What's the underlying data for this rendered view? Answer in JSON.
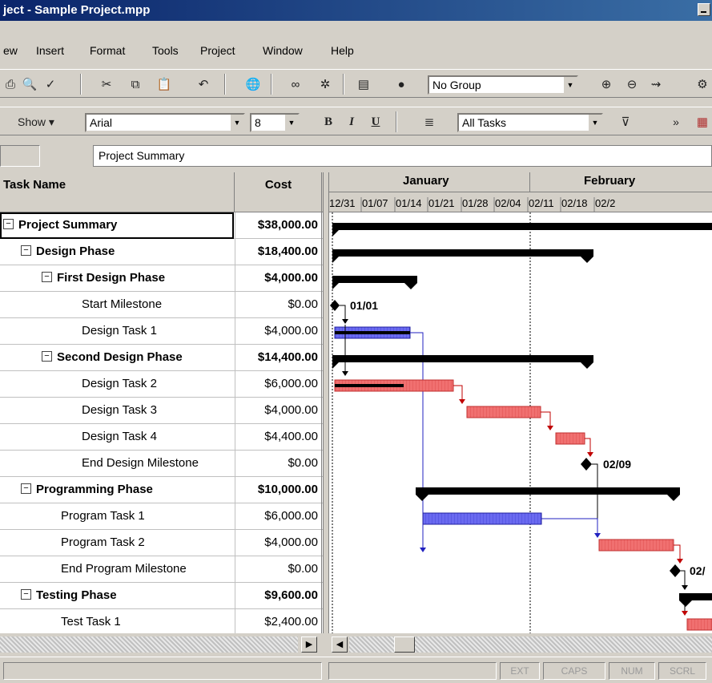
{
  "window": {
    "title": "ject - Sample Project.mpp"
  },
  "menu": [
    {
      "label": "ew"
    },
    {
      "label": "Insert"
    },
    {
      "label": "Format"
    },
    {
      "label": "Tools"
    },
    {
      "label": "Project"
    },
    {
      "label": "Window"
    },
    {
      "label": "Help"
    }
  ],
  "toolbar1": {
    "group_value": "No Group"
  },
  "toolbar2": {
    "show_label": "Show ▾",
    "font_value": "Arial",
    "size_value": "8",
    "filter_value": "All Tasks",
    "more": "»"
  },
  "entry_bar": {
    "value": "Project Summary"
  },
  "table": {
    "header_name": "Task Name",
    "header_cost": "Cost",
    "rows": [
      {
        "name": "Project Summary",
        "cost": "$38,000.00"
      },
      {
        "name": "Design Phase",
        "cost": "$18,400.00"
      },
      {
        "name": "First Design Phase",
        "cost": "$4,000.00"
      },
      {
        "name": "Start Milestone",
        "cost": "$0.00"
      },
      {
        "name": "Design Task 1",
        "cost": "$4,000.00"
      },
      {
        "name": "Second Design Phase",
        "cost": "$14,400.00"
      },
      {
        "name": "Design Task 2",
        "cost": "$6,000.00"
      },
      {
        "name": "Design Task 3",
        "cost": "$4,000.00"
      },
      {
        "name": "Design Task 4",
        "cost": "$4,400.00"
      },
      {
        "name": "End Design Milestone",
        "cost": "$0.00"
      },
      {
        "name": "Programming Phase",
        "cost": "$10,000.00"
      },
      {
        "name": "Program Task 1",
        "cost": "$6,000.00"
      },
      {
        "name": "Program Task 2",
        "cost": "$4,000.00"
      },
      {
        "name": "End Program Milestone",
        "cost": "$0.00"
      },
      {
        "name": "Testing Phase",
        "cost": "$9,600.00"
      },
      {
        "name": "Test Task 1",
        "cost": "$2,400.00"
      }
    ]
  },
  "gantt": {
    "months": [
      "January",
      "February"
    ],
    "weeks": [
      "12/31",
      "01/07",
      "01/14",
      "01/21",
      "01/28",
      "02/04",
      "02/11",
      "02/18",
      "02/2"
    ],
    "milestone_labels": [
      "01/01",
      "02/09",
      "02/"
    ]
  },
  "status": {
    "ext": "EXT",
    "caps": "CAPS",
    "num": "NUM",
    "scrl": "SCRL"
  },
  "colors": {
    "critical": "#f07070",
    "normal": "#6a6af0",
    "summary": "#000000",
    "title_bar": "#0a246a"
  }
}
